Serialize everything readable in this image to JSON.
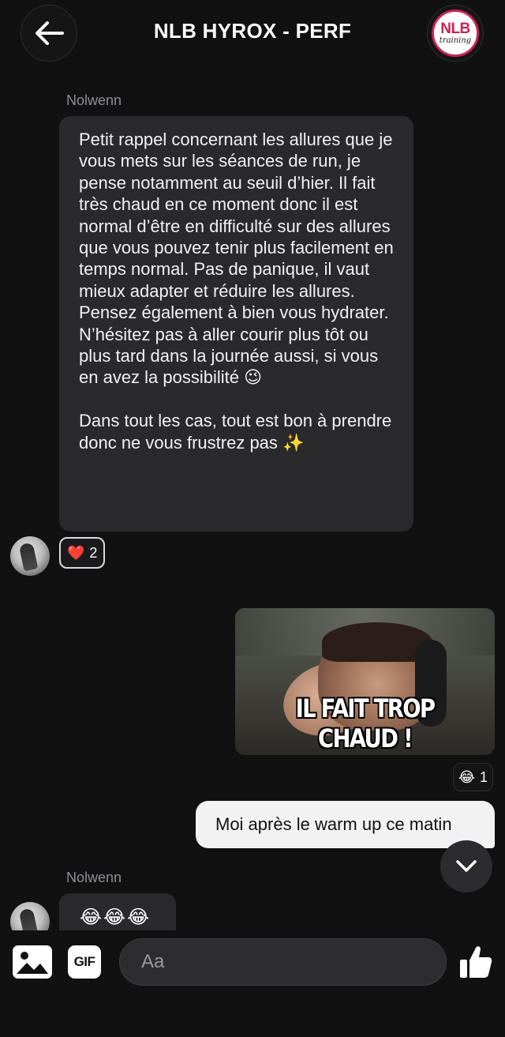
{
  "header": {
    "title": "NLB HYROX - PERF",
    "logo_text_top": "NLB",
    "logo_text_bottom": "training"
  },
  "messages": [
    {
      "sender": "Nolwenn",
      "text": "Petit rappel concernant les allures que je vous mets sur les séances de run, je pense notamment au seuil d’hier. Il fait très chaud en ce moment donc il est normal d’être en difficulté sur des allures que vous pouvez tenir plus facilement en temps normal. Pas de panique, il vaut mieux adapter et réduire les allures. Pensez également à bien vous hydrater. N’hésitez pas à aller courir plus tôt ou plus tard dans la journée aussi, si vous en avez la possibilité 😉\n\nDans tout les cas, tout est bon à prendre donc ne vous frustrez pas ✨",
      "reaction": {
        "emoji": "❤️",
        "count": "2"
      }
    },
    {
      "gif_caption": "IL FAIT TROP CHAUD !",
      "reaction": {
        "emoji": "😂",
        "count": "1"
      }
    },
    {
      "text": "Moi après le warm up ce matin"
    },
    {
      "sender": "Nolwenn",
      "text": "😂😂😂"
    }
  ],
  "composer": {
    "gif_label": "GIF",
    "placeholder": "Aa"
  },
  "icons": {
    "back": "arrow-left-icon",
    "scroll": "chevron-down-icon",
    "image": "image-icon",
    "like": "thumbs-up-icon"
  },
  "colors": {
    "background": "#111112",
    "incoming_bubble": "#2a2a2c",
    "outgoing_bubble": "#f2f2f3",
    "brand": "#c92354"
  }
}
